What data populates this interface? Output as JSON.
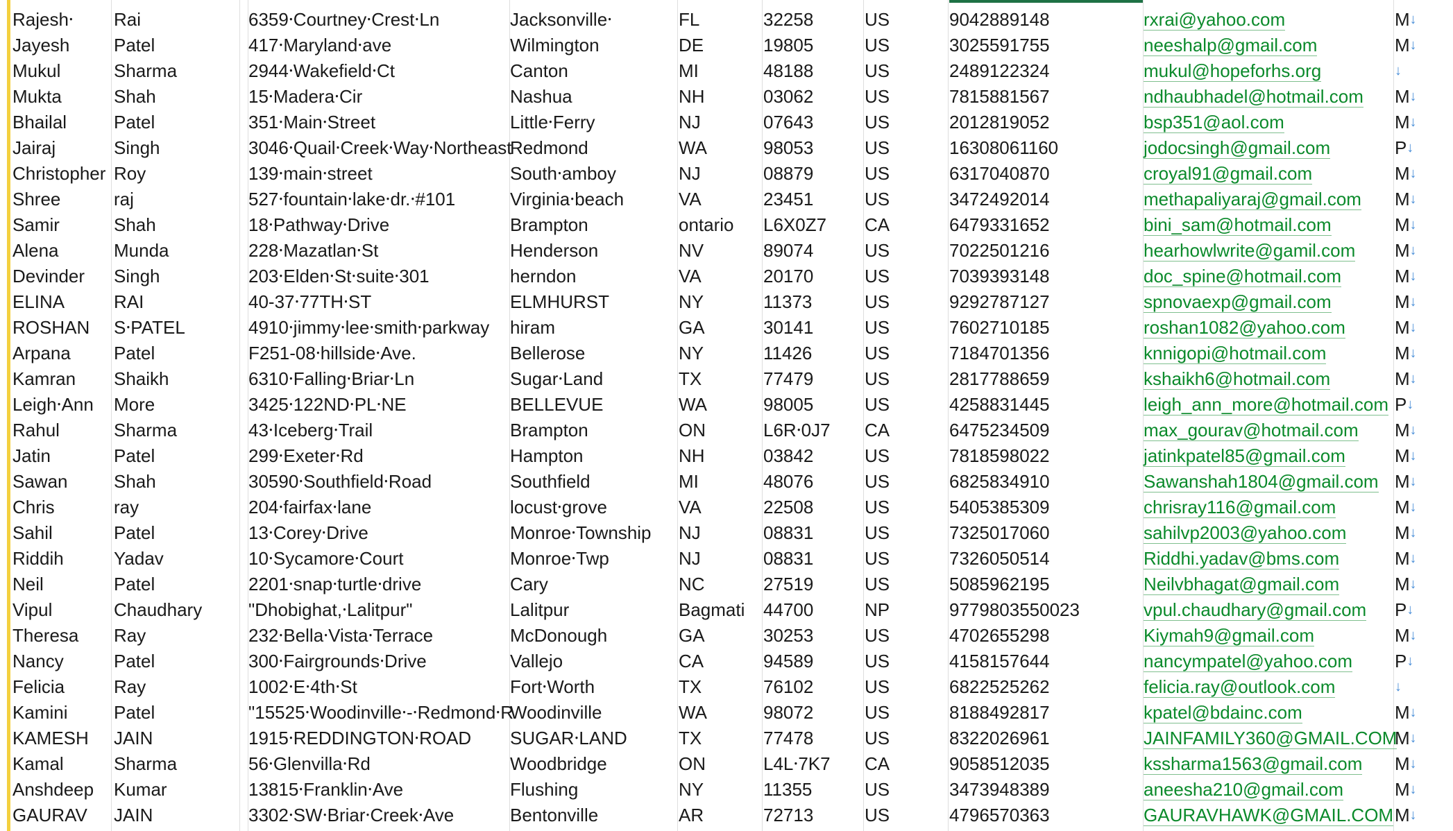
{
  "rows": [
    [
      "Rajesh⸱",
      "Rai",
      "6359⸱Courtney⸱Crest⸱Ln",
      "Jacksonville⸱",
      "FL",
      "32258",
      "US",
      "9042889148",
      "rxrai@yahoo.com",
      "M"
    ],
    [
      "Jayesh",
      "Patel",
      "417⸱Maryland⸱ave",
      "Wilmington",
      "DE",
      "19805",
      "US",
      "3025591755",
      "neeshalp@gmail.com",
      "M"
    ],
    [
      "Mukul",
      "Sharma",
      "2944⸱Wakefield⸱Ct",
      "Canton",
      "MI",
      "48188",
      "US",
      "2489122324",
      "mukul@hopeforhs.org",
      ""
    ],
    [
      "Mukta",
      "Shah",
      "15⸱Madera⸱Cir",
      "Nashua",
      "NH",
      "03062",
      "US",
      "7815881567",
      "ndhaubhadel@hotmail.com",
      "M"
    ],
    [
      "Bhailal",
      "Patel",
      "351⸱Main⸱Street",
      "Little⸱Ferry",
      "NJ",
      "07643",
      "US",
      "2012819052",
      "bsp351@aol.com",
      "M"
    ],
    [
      "Jairaj",
      "Singh",
      "3046⸱Quail⸱Creek⸱Way⸱Northeast",
      "Redmond",
      "WA",
      "98053",
      "US",
      "16308061160",
      "jodocsingh@gmail.com",
      "P"
    ],
    [
      "Christopher",
      "Roy",
      "139⸱main⸱street",
      "South⸱amboy",
      "NJ",
      "08879",
      "US",
      "6317040870",
      "croyal91@gmail.com",
      "M"
    ],
    [
      "Shree",
      "raj",
      "527⸱fountain⸱lake⸱dr.⸱#101",
      "Virginia⸱beach",
      "VA",
      "23451",
      "US",
      "3472492014",
      "methapaliyaraj@gmail.com",
      "M"
    ],
    [
      "Samir",
      "Shah",
      "18⸱Pathway⸱Drive",
      "Brampton",
      "ontario",
      "L6X0Z7",
      "CA",
      "6479331652",
      "bini_sam@hotmail.com",
      "M"
    ],
    [
      "Alena",
      "Munda",
      "228⸱Mazatlan⸱St",
      "Henderson",
      "NV",
      "89074",
      "US",
      "7022501216",
      "hearhowlwrite@gamil.com",
      "M"
    ],
    [
      "Devinder",
      "Singh",
      "203⸱Elden⸱St⸱suite⸱301",
      "herndon",
      "VA",
      "20170",
      "US",
      "7039393148",
      "doc_spine@hotmail.com",
      "M"
    ],
    [
      "ELINA",
      "RAI",
      "40-37⸱77TH⸱ST",
      "ELMHURST",
      "NY",
      "11373",
      "US",
      "9292787127",
      "spnovaexp@gmail.com",
      "M"
    ],
    [
      "ROSHAN",
      "S⸱PATEL",
      "4910⸱jimmy⸱lee⸱smith⸱parkway",
      "hiram",
      "GA",
      "30141",
      "US",
      "7602710185",
      "roshan1082@yahoo.com",
      "M"
    ],
    [
      "Arpana",
      "Patel",
      "F251-08⸱hillside⸱Ave.",
      "Bellerose",
      "NY",
      "11426",
      "US",
      "7184701356",
      "knnigopi@hotmail.com",
      "M"
    ],
    [
      "Kamran",
      "Shaikh",
      "6310⸱Falling⸱Briar⸱Ln",
      "Sugar⸱Land",
      "TX",
      "77479",
      "US",
      "2817788659",
      "kshaikh6@hotmail.com",
      "M"
    ],
    [
      "Leigh⸱Ann",
      "More",
      "3425⸱122ND⸱PL⸱NE",
      "BELLEVUE",
      "WA",
      "98005",
      "US",
      "4258831445",
      "leigh_ann_more@hotmail.com",
      "P"
    ],
    [
      "Rahul",
      "Sharma",
      "43⸱Iceberg⸱Trail",
      "Brampton",
      "ON",
      "L6R⸱0J7",
      "CA",
      "6475234509",
      "max_gourav@hotmail.com",
      "M"
    ],
    [
      "Jatin",
      "Patel",
      "299⸱Exeter⸱Rd",
      "Hampton",
      "NH",
      "03842",
      "US",
      "7818598022",
      "jatinkpatel85@gmail.com",
      "M"
    ],
    [
      "Sawan",
      "Shah",
      "30590⸱Southfield⸱Road",
      "Southfield",
      "MI",
      "48076",
      "US",
      "6825834910",
      "Sawanshah1804@gmail.com",
      "M"
    ],
    [
      "Chris",
      "ray",
      "204⸱fairfax⸱lane",
      "locust⸱grove",
      "VA",
      "22508",
      "US",
      "5405385309",
      "chrisray116@gmail.com",
      "M"
    ],
    [
      "Sahil",
      "Patel",
      "13⸱Corey⸱Drive",
      "Monroe⸱Township",
      "NJ",
      "08831",
      "US",
      "7325017060",
      "sahilvp2003@yahoo.com",
      "M"
    ],
    [
      "Riddih",
      "Yadav",
      "10⸱Sycamore⸱Court",
      "Monroe⸱Twp",
      "NJ",
      "08831",
      "US",
      "7326050514",
      "Riddhi.yadav@bms.com",
      "M"
    ],
    [
      "Neil",
      "Patel",
      "2201⸱snap⸱turtle⸱drive",
      "Cary",
      "NC",
      "27519",
      "US",
      "5085962195",
      "Neilvbhagat@gmail.com",
      "M"
    ],
    [
      "Vipul",
      "Chaudhary",
      "\"Dhobighat,⸱Lalitpur\"",
      "Lalitpur",
      "Bagmati",
      "44700",
      "NP",
      "9779803550023",
      "vpul.chaudhary@gmail.com",
      "P"
    ],
    [
      "Theresa",
      "Ray",
      "232⸱Bella⸱Vista⸱Terrace",
      "McDonough",
      "GA",
      "30253",
      "US",
      "4702655298",
      "Kiymah9@gmail.com",
      "M"
    ],
    [
      "Nancy",
      "Patel",
      "300⸱Fairgrounds⸱Drive",
      "Vallejo",
      "CA",
      "94589",
      "US",
      "4158157644",
      "nancympatel@yahoo.com",
      "P"
    ],
    [
      "Felicia",
      "Ray",
      "1002⸱E⸱4th⸱St",
      "Fort⸱Worth",
      "TX",
      "76102",
      "US",
      "6822525262",
      "felicia.ray@outlook.com",
      ""
    ],
    [
      "Kamini",
      "Patel",
      "\"15525⸱Woodinville⸱-⸱Redmond⸱R",
      "Woodinville",
      "WA",
      "98072",
      "US",
      "8188492817",
      "kpatel@bdainc.com",
      "M"
    ],
    [
      "KAMESH",
      "JAIN",
      "1915⸱REDDINGTON⸱ROAD",
      "SUGAR⸱LAND",
      "TX",
      "77478",
      "US",
      "8322026961",
      "JAINFAMILY360@GMAIL.COM",
      "M"
    ],
    [
      "Kamal",
      "Sharma",
      "56⸱Glenvilla⸱Rd",
      "Woodbridge",
      "ON",
      "L4L⸱7K7",
      "CA",
      "9058512035",
      "kssharma1563@gmail.com",
      "M"
    ],
    [
      "Anshdeep",
      "Kumar",
      "13815⸱Franklin⸱Ave",
      "Flushing",
      "NY",
      "11355",
      "US",
      "3473948389",
      "aneesha210@gmail.com",
      "M"
    ],
    [
      "GAURAV",
      "JAIN",
      "3302⸱SW⸱Briar⸱Creek⸱Ave",
      "Bentonville",
      "AR",
      "72713",
      "US",
      "4796570363",
      "GAURAVHAWK@GMAIL.COM",
      "M"
    ]
  ],
  "icons": {
    "dropdown": "chevron-down-icon"
  },
  "colors": {
    "email": "#0b8a2b",
    "accent_bar": "#f4d03f",
    "selection": "#1e7145",
    "arrow": "#4a8fd8"
  }
}
